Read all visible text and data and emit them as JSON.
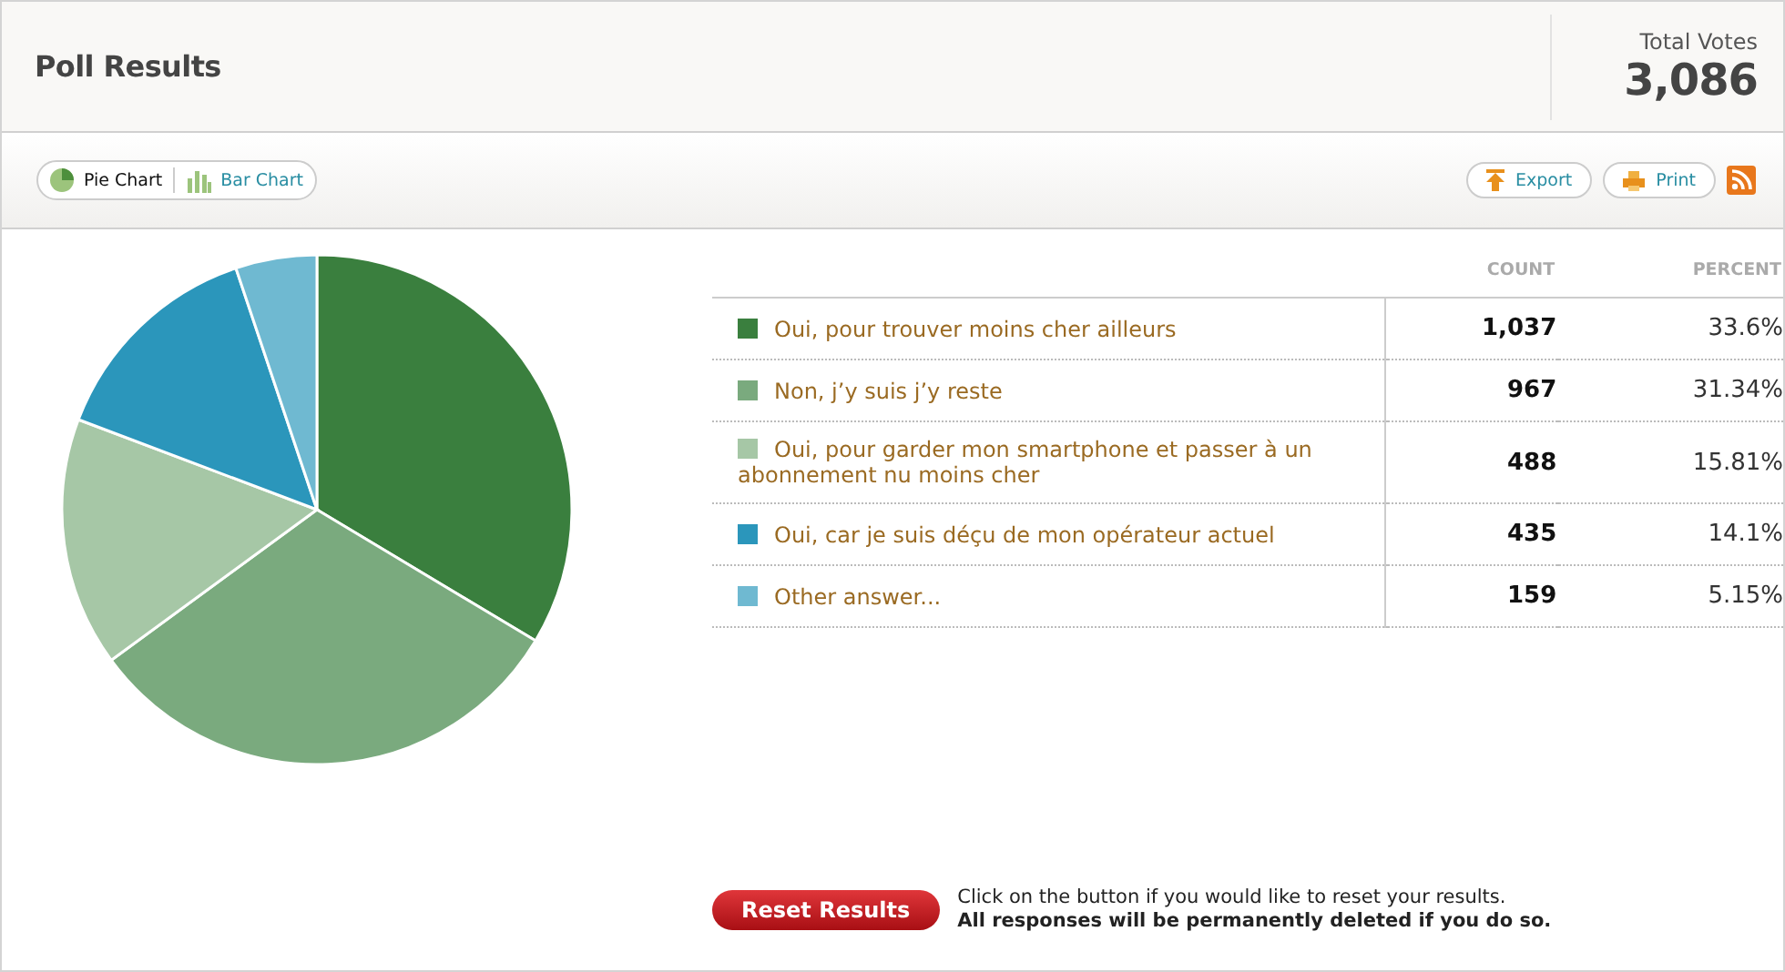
{
  "header": {
    "title": "Poll Results",
    "total_label": "Total Votes",
    "total_value": "3,086"
  },
  "view_tabs": [
    {
      "label": "Pie Chart",
      "kind": "pie",
      "selected": true
    },
    {
      "label": "Bar Chart",
      "kind": "bar",
      "selected": false
    }
  ],
  "actions": [
    {
      "label": "Export",
      "kind": "export"
    },
    {
      "label": "Print",
      "kind": "print"
    }
  ],
  "chart_data": {
    "type": "pie",
    "values": [
      33.6,
      31.34,
      15.81,
      14.1,
      5.15
    ]
  },
  "table": {
    "columns": [
      "COUNT",
      "PERCENT"
    ],
    "rows": [
      {
        "answer": "Oui, pour trouver moins cher ailleurs",
        "count": "1,037",
        "percent": "33.6%",
        "color": "#3a7f3e"
      },
      {
        "answer": "Non, j’y suis j’y reste",
        "count": "967",
        "percent": "31.34%",
        "color": "#7aaa7e"
      },
      {
        "answer": "Oui, pour garder mon smartphone et passer à un abonnement nu moins cher",
        "count": "488",
        "percent": "15.81%",
        "color": "#a6c7a6"
      },
      {
        "answer": "Oui, car je suis déçu de mon opérateur actuel",
        "count": "435",
        "percent": "14.1%",
        "color": "#2b96bb"
      },
      {
        "answer": "Other answer...",
        "count": "159",
        "percent": "5.15%",
        "color": "#6fb9d1"
      }
    ]
  },
  "reset": {
    "button": "Reset Results",
    "note": "Click on the button if you would like to reset your results.",
    "warning": "All responses will be permanently deleted if you do so."
  }
}
